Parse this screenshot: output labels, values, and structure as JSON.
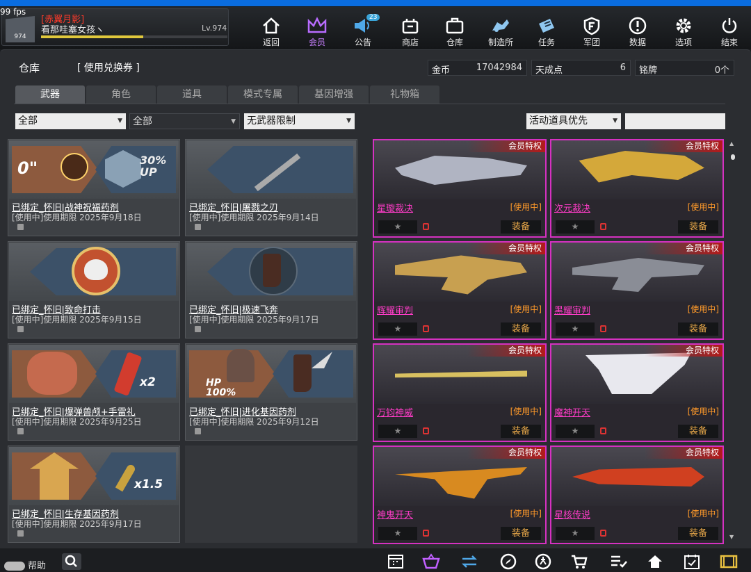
{
  "fps": "99 fps",
  "player": {
    "clan": "[赤翼月影]",
    "name": "看那哇塞女孩ヽ",
    "level": "Lv.974",
    "badge": "974",
    "xp_fraction": 0.55
  },
  "nav": [
    {
      "label": "返回",
      "icon": "home-icon"
    },
    {
      "label": "会员",
      "icon": "crown-icon"
    },
    {
      "label": "公告",
      "icon": "megaphone-icon",
      "badge": "23"
    },
    {
      "label": "商店",
      "icon": "shop-icon"
    },
    {
      "label": "仓库",
      "icon": "briefcase-icon"
    },
    {
      "label": "制造所",
      "icon": "factory-icon"
    },
    {
      "label": "任务",
      "icon": "ticket-icon"
    },
    {
      "label": "军团",
      "icon": "shield-f-icon"
    },
    {
      "label": "数据",
      "icon": "info-icon"
    },
    {
      "label": "选项",
      "icon": "gear-icon"
    },
    {
      "label": "结束",
      "icon": "power-icon"
    }
  ],
  "panel": {
    "title": "仓库",
    "redeem": "[ 使用兑换券 ]"
  },
  "currency": {
    "gold_label": "金币",
    "gold_value": "17042984",
    "points_label": "天成点",
    "points_value": "6",
    "medal_label": "铭牌",
    "medal_value": "0个"
  },
  "tabs": [
    "武器",
    "角色",
    "道具",
    "模式专属",
    "基因增强",
    "礼物箱"
  ],
  "filters": {
    "filter1": "全部",
    "filter2": "全部",
    "filter3": "无武器限制",
    "sort": "活动道具优先",
    "search_placeholder": ""
  },
  "items": [
    {
      "name": "已绑定_怀旧|战神祝福药剂",
      "date": "[使用中]使用期限 2025年9月18日",
      "left_text": "0\"",
      "right_text": "30% UP"
    },
    {
      "name": "已绑定_怀旧|屠戮之刃",
      "date": "[使用中]使用期限 2025年9月14日"
    },
    {
      "name": "已绑定_怀旧|致命打击",
      "date": "[使用中]使用期限 2025年9月15日"
    },
    {
      "name": "已绑定_怀旧|极速飞奔",
      "date": "[使用中]使用期限 2025年9月17日"
    },
    {
      "name": "已绑定_怀旧|爆弹兽颅+手雷礼",
      "date": "[使用中]使用期限 2025年9月25日",
      "right_text": "x2"
    },
    {
      "name": "已绑定_怀旧|进化基因药剂",
      "date": "[使用中]使用期限 2025年9月12日",
      "left_text": "HP 100%"
    },
    {
      "name": "已绑定_怀旧|生存基因药剂",
      "date": "[使用中]使用期限 2025年9月17日",
      "right_text": "x1.5"
    }
  ],
  "weapons": [
    {
      "name": "星璇裁决",
      "status": "[使用中]",
      "vip": "会员特权",
      "equip": "装备",
      "fav": "★"
    },
    {
      "name": "次元裁决",
      "status": "[使用中]",
      "vip": "会员特权",
      "equip": "装备",
      "fav": "★"
    },
    {
      "name": "辉耀审判",
      "status": "[使用中]",
      "vip": "会员特权",
      "equip": "装备",
      "fav": "★"
    },
    {
      "name": "黑耀审判",
      "status": "[使用中]",
      "vip": "会员特权",
      "equip": "装备",
      "fav": "★"
    },
    {
      "name": "万钧神威",
      "status": "[使用中]",
      "vip": "会员特权",
      "equip": "装备",
      "fav": "★"
    },
    {
      "name": "魔神开天",
      "status": "[使用中]",
      "vip": "会员特权",
      "equip": "装备",
      "fav": "★"
    },
    {
      "name": "神鬼开天",
      "status": "[使用中]",
      "vip": "会员特权",
      "equip": "装备",
      "fav": "★"
    },
    {
      "name": "星核传说",
      "status": "[使用中]",
      "vip": "会员特权",
      "equip": "装备",
      "fav": "★"
    }
  ],
  "footer": {
    "help": "帮助"
  }
}
